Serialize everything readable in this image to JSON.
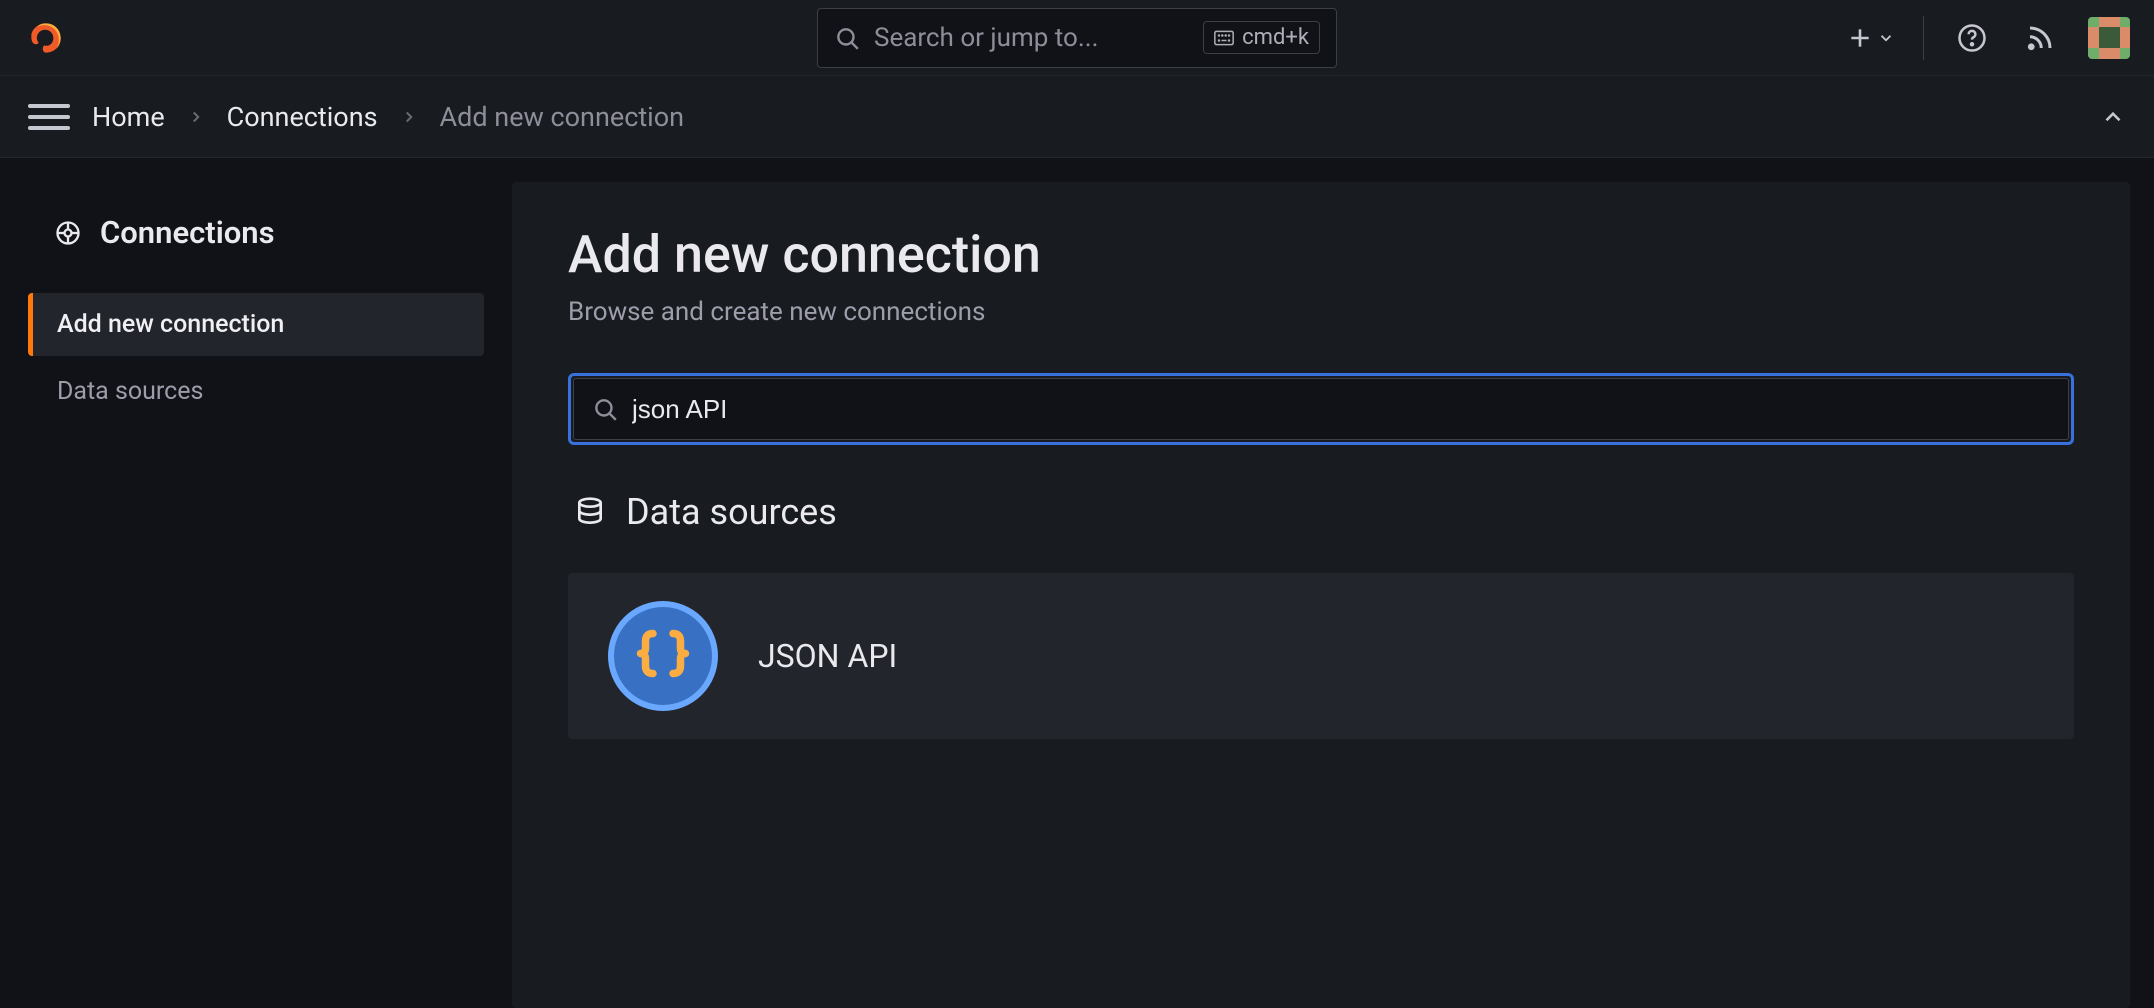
{
  "topbar": {
    "search_placeholder": "Search or jump to...",
    "shortcut": "cmd+k"
  },
  "breadcrumb": {
    "items": [
      "Home",
      "Connections",
      "Add new connection"
    ]
  },
  "sidebar": {
    "title": "Connections",
    "items": [
      {
        "label": "Add new connection",
        "active": true
      },
      {
        "label": "Data sources",
        "active": false
      }
    ]
  },
  "page": {
    "title": "Add new connection",
    "subtitle": "Browse and create new connections",
    "search_value": "json API",
    "section_heading": "Data sources",
    "results": [
      {
        "name": "JSON API"
      }
    ]
  }
}
